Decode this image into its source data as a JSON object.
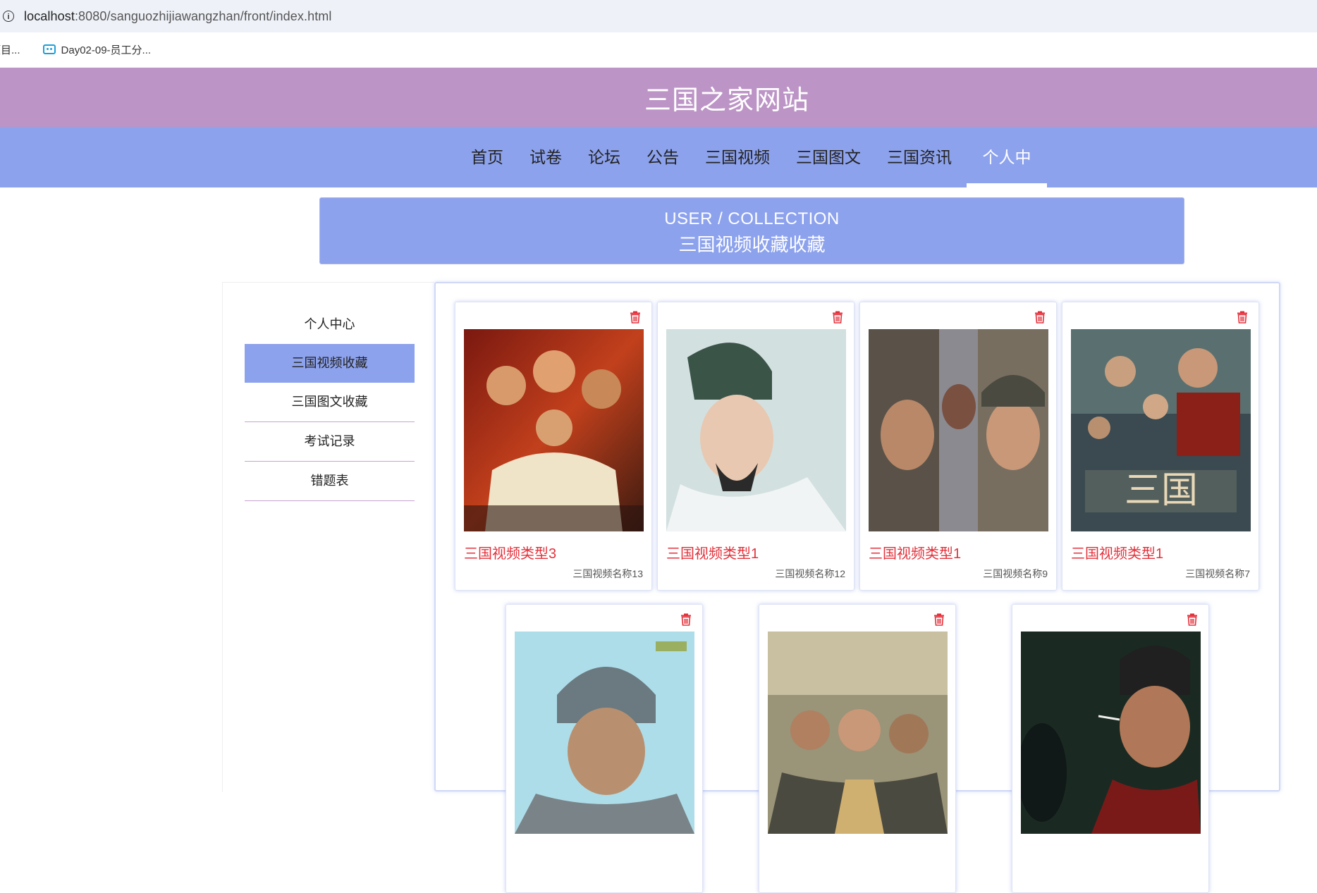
{
  "browser": {
    "url_host": "localhost",
    "url_path": ":8080/sanguozhijiawangzhan/front/index.html",
    "bookmarks": [
      "项目...",
      "Day02-09-员工分..."
    ]
  },
  "site": {
    "title": "三国之家网站",
    "nav": [
      "首页",
      "试卷",
      "论坛",
      "公告",
      "三国视频",
      "三国图文",
      "三国资讯",
      "个人中心"
    ],
    "active_nav": "个人中心"
  },
  "banner": {
    "en": "USER / COLLECTION",
    "cn": "三国视频收藏收藏"
  },
  "side_menu": {
    "items": [
      "个人中心",
      "三国视频收藏",
      "三国图文收藏",
      "考试记录",
      "错题表"
    ],
    "active": "三国视频收藏"
  },
  "cards": [
    {
      "type": "三国视频类型3",
      "name": "三国视频名称13",
      "icon": "trash-icon"
    },
    {
      "type": "三国视频类型1",
      "name": "三国视频名称12",
      "icon": "trash-icon"
    },
    {
      "type": "三国视频类型1",
      "name": "三国视频名称9",
      "icon": "trash-icon"
    },
    {
      "type": "三国视频类型1",
      "name": "三国视频名称7",
      "icon": "trash-icon"
    },
    {
      "type": "",
      "name": "",
      "icon": "trash-icon"
    },
    {
      "type": "",
      "name": "",
      "icon": "trash-icon"
    },
    {
      "type": "",
      "name": "",
      "icon": "trash-icon"
    }
  ],
  "colors": {
    "header_bg": "#bc94c6",
    "nav_bg": "#8da2ed",
    "type_text": "#e3313b",
    "side_border": "#c9a2d0"
  }
}
